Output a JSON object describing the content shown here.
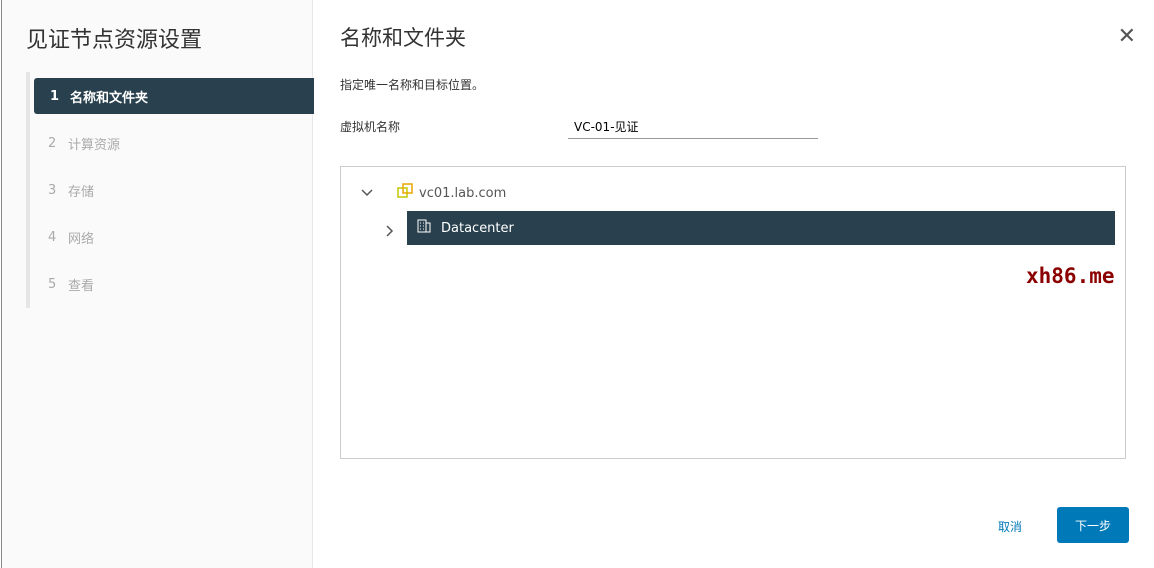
{
  "wizard": {
    "title": "见证节点资源设置",
    "steps": [
      {
        "num": "1",
        "label": "名称和文件夹"
      },
      {
        "num": "2",
        "label": "计算资源"
      },
      {
        "num": "3",
        "label": "存储"
      },
      {
        "num": "4",
        "label": "网络"
      },
      {
        "num": "5",
        "label": "查看"
      }
    ]
  },
  "page": {
    "title": "名称和文件夹",
    "description": "指定唯一名称和目标位置。",
    "vm_name_label": "虚拟机名称",
    "vm_name_value": "VC-01-见证"
  },
  "tree": {
    "root": "vc01.lab.com",
    "child": "Datacenter"
  },
  "watermark": "xh86.me",
  "footer": {
    "cancel": "取消",
    "next": "下一步"
  }
}
